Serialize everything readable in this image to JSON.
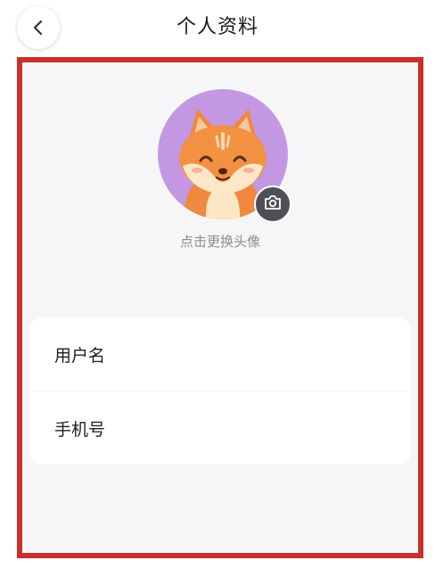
{
  "header": {
    "title": "个人资料",
    "back_icon": "chevron-left-icon"
  },
  "profile": {
    "avatar_description": "cartoon fox avatar",
    "avatar_bg_color": "#c497e3",
    "camera_icon": "camera-icon",
    "change_avatar_label": "点击更换头像"
  },
  "form": {
    "rows": [
      {
        "label": "用户名",
        "value": ""
      },
      {
        "label": "手机号",
        "value": ""
      }
    ]
  },
  "colors": {
    "highlight_border": "#c9302c",
    "content_bg": "#f6f6f8"
  }
}
